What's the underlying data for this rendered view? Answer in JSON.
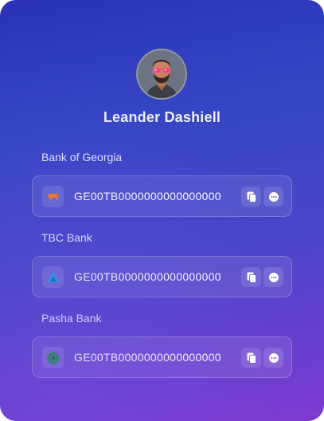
{
  "profile": {
    "name": "Leander Dashiell",
    "avatar_icon": "avatar-person-with-sunglasses"
  },
  "accounts": [
    {
      "bank": "Bank of Georgia",
      "iban": "GE00TB0000000000000000",
      "icon": "lion-logo-icon",
      "icon_color": "#f07c22"
    },
    {
      "bank": "TBC Bank",
      "iban": "GE00TB0000000000000000",
      "icon": "triangle-logo-icon",
      "icon_color": "#1aa3e8"
    },
    {
      "bank": "Pasha Bank",
      "iban": "GE00TB0000000000000000",
      "icon": "flower-logo-icon",
      "icon_color": "#1f8e4a"
    }
  ],
  "actions": {
    "copy_icon": "copy-icon",
    "more_icon": "more-icon"
  },
  "colors": {
    "gradient_top": "#2b32b8",
    "gradient_bottom": "#7e3bd0"
  }
}
